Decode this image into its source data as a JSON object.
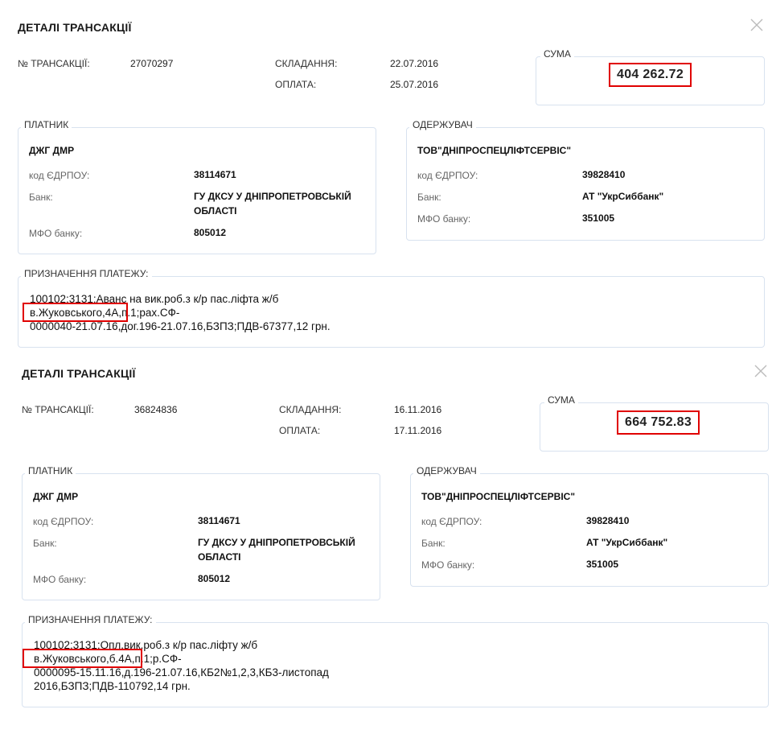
{
  "panels": [
    {
      "title": "ДЕТАЛІ ТРАНСАКЦІЇ",
      "tx_label": "№ ТРАНСАКЦІЇ:",
      "tx_number": "27070297",
      "compiled_label": "СКЛАДАННЯ:",
      "compiled_date": "22.07.2016",
      "payment_label": "ОПЛАТА:",
      "payment_date": "25.07.2016",
      "sum_label": "СУМА",
      "sum_value": "404 262.72",
      "payer": {
        "legend": "ПЛАТНИК",
        "name": "ДЖГ ДМР",
        "edrpou_label": "код ЄДРПОУ:",
        "edrpou": "38114671",
        "bank_label": "Банк:",
        "bank_line1": "ГУ ДКСУ У ДНІПРОПЕТРОВСЬКІЙ",
        "bank_line2": "ОБЛАСТІ",
        "mfo_label": "МФО банку:",
        "mfo": "805012"
      },
      "receiver": {
        "legend": "ОДЕРЖУВАЧ",
        "name": "ТОВ\"ДНІПРОСПЕЦЛІФТСЕРВІС\"",
        "edrpou_label": "код ЄДРПОУ:",
        "edrpou": "39828410",
        "bank_label": "Банк:",
        "bank": "АТ \"УкрСиббанк\"",
        "mfo_label": "МФО банку:",
        "mfo": "351005"
      },
      "purpose_label": "ПРИЗНАЧЕННЯ ПЛАТЕЖУ:",
      "purpose_lines": [
        "100102;3131;Аванс на вик.роб.з к/р пас.ліфта ж/б",
        "в.Жуковського,4А,п.1;рах.СФ-",
        "0000040-21.07.16,дог.196-21.07.16,БЗПЗ;ПДВ-67377,12 грн."
      ]
    },
    {
      "title": "ДЕТАЛІ ТРАНСАКЦІЇ",
      "tx_label": "№ ТРАНСАКЦІЇ:",
      "tx_number": "36824836",
      "compiled_label": "СКЛАДАННЯ:",
      "compiled_date": "16.11.2016",
      "payment_label": "ОПЛАТА:",
      "payment_date": "17.11.2016",
      "sum_label": "СУМА",
      "sum_value": "664 752.83",
      "payer": {
        "legend": "ПЛАТНИК",
        "name": "ДЖГ ДМР",
        "edrpou_label": "код ЄДРПОУ:",
        "edrpou": "38114671",
        "bank_label": "Банк:",
        "bank_line1": "ГУ ДКСУ У ДНІПРОПЕТРОВСЬКІЙ",
        "bank_line2": "ОБЛАСТІ",
        "mfo_label": "МФО банку:",
        "mfo": "805012"
      },
      "receiver": {
        "legend": "ОДЕРЖУВАЧ",
        "name": "ТОВ\"ДНІПРОСПЕЦЛІФТСЕРВІС\"",
        "edrpou_label": "код ЄДРПОУ:",
        "edrpou": "39828410",
        "bank_label": "Банк:",
        "bank": "АТ \"УкрСиббанк\"",
        "mfo_label": "МФО банку:",
        "mfo": "351005"
      },
      "purpose_label": "ПРИЗНАЧЕННЯ ПЛАТЕЖУ:",
      "purpose_lines": [
        "100102;3131;Опл.вик.роб.з к/р пас.ліфту ж/б",
        "в.Жуковського,б.4А,п.1;р.СФ-",
        "0000095-15.11.16,д.196-21.07.16,КБ2№1,2,3,КБ3-листопад",
        "2016,БЗПЗ;ПДВ-110792,14 грн."
      ]
    }
  ],
  "icons": {
    "close": "close-icon"
  },
  "colors": {
    "highlight": "#e00000",
    "border": "#d8e2ef"
  }
}
